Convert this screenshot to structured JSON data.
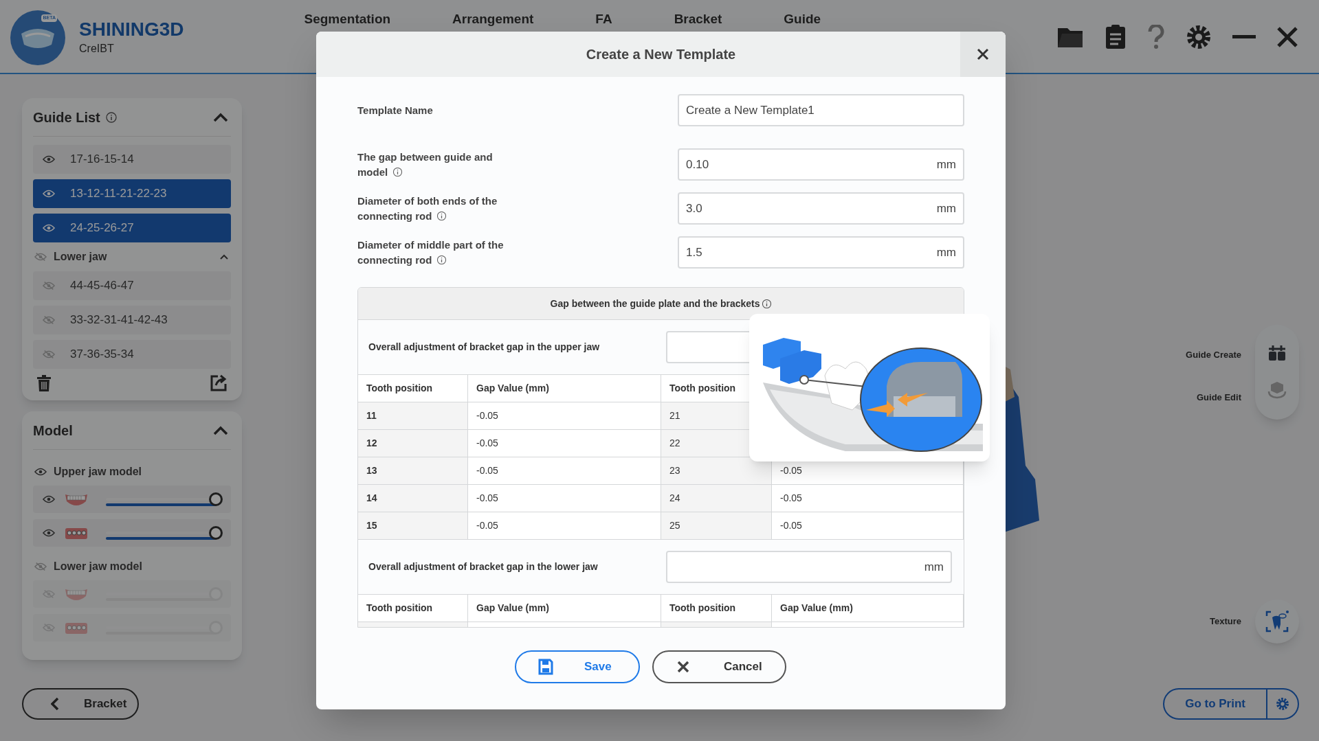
{
  "header": {
    "logo_badge": "BETA",
    "brand": "SHINING3D",
    "product": "CreIBT"
  },
  "nav": [
    {
      "label": "Segmentation"
    },
    {
      "label": "Arrangement"
    },
    {
      "label": "FA"
    },
    {
      "label": "Bracket"
    },
    {
      "label": "Guide"
    }
  ],
  "guide_list": {
    "title": "Guide List",
    "expanded": true,
    "items": [
      {
        "label": "17-16-15-14",
        "visible": true,
        "selected": false
      },
      {
        "label": "13-12-11-21-22-23",
        "visible": true,
        "selected": true
      },
      {
        "label": "24-25-26-27",
        "visible": true,
        "selected": true
      }
    ],
    "lower_jaw": {
      "label": "Lower jaw",
      "visible": false,
      "expanded": true,
      "items": [
        {
          "label": "44-45-46-47",
          "visible": false,
          "selected": false
        },
        {
          "label": "33-32-31-41-42-43",
          "visible": false,
          "selected": false
        },
        {
          "label": "37-36-35-34",
          "visible": false,
          "selected": false
        }
      ]
    }
  },
  "model": {
    "title": "Model",
    "expanded": true,
    "groups": [
      {
        "label": "Upper jaw model",
        "visible": true,
        "items": [
          {
            "kind": "teeth",
            "visible": true,
            "level": 1
          },
          {
            "kind": "brackets",
            "visible": true,
            "level": 1
          }
        ]
      },
      {
        "label": "Lower jaw model",
        "visible": false,
        "items": [
          {
            "kind": "teeth",
            "visible": false,
            "level": 1
          },
          {
            "kind": "brackets",
            "visible": false,
            "level": 1
          }
        ]
      }
    ]
  },
  "back_button": "Bracket",
  "tools": [
    {
      "label": "Guide Create",
      "kind": "create",
      "disabled": false
    },
    {
      "label": "Guide Edit",
      "kind": "edit",
      "disabled": true
    }
  ],
  "texture": {
    "label": "Texture"
  },
  "print_button": "Go to Print",
  "dialog": {
    "title": "Create a New Template",
    "fields": [
      {
        "label": "Template Name",
        "value": "Create a New Template1"
      },
      {
        "label": "The gap between guide and model",
        "value": "0.10",
        "unit": "mm",
        "info": true
      },
      {
        "label": "Diameter of both ends of the connecting rod",
        "value": "3.0",
        "unit": "mm",
        "info": true
      },
      {
        "label": "Diameter of middle part of the connecting rod",
        "value": "1.5",
        "unit": "mm",
        "info": true
      }
    ],
    "section_title": "Gap between the guide plate and the brackets",
    "upper": {
      "label": "Overall adjustment of bracket gap in the upper jaw",
      "columns": [
        "Tooth position",
        "Gap Value (mm)",
        "Tooth position"
      ],
      "rows": [
        {
          "tooth": "11",
          "gap": "-0.05",
          "tooth_2": "21"
        },
        {
          "tooth": "12",
          "gap": "-0.05",
          "tooth_2": "22"
        },
        {
          "tooth": "13",
          "gap": "-0.05",
          "tooth_2": "23",
          "gap_2": "-0.05"
        },
        {
          "tooth": "14",
          "gap": "-0.05",
          "tooth_2": "24",
          "gap_2": "-0.05"
        },
        {
          "tooth": "15",
          "gap": "-0.05",
          "tooth_2": "25",
          "gap_2": "-0.05"
        }
      ]
    },
    "lower": {
      "label": "Overall adjustment of bracket gap in the lower jaw",
      "unit": "mm",
      "columns": [
        "Tooth position",
        "Gap Value (mm)",
        "Tooth position",
        "Gap Value (mm)"
      ]
    },
    "save": "Save",
    "cancel": "Cancel"
  }
}
